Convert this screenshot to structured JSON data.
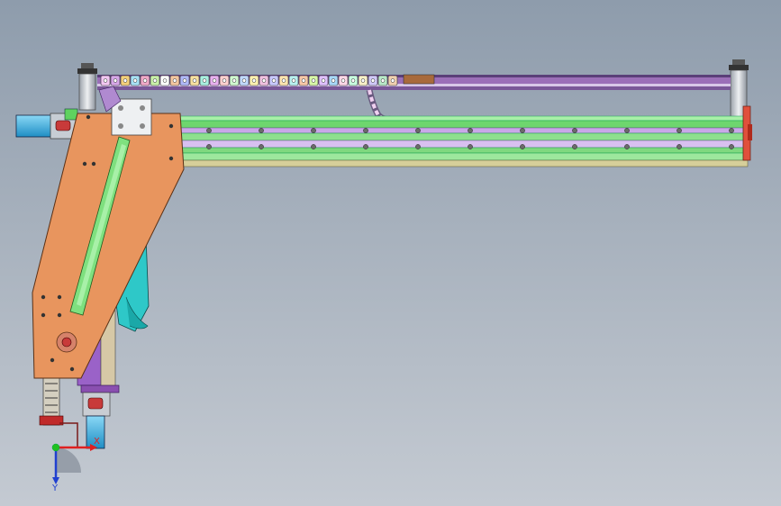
{
  "viewport": {
    "background_top": "#8e9cac",
    "background_bottom": "#c4cad2"
  },
  "colors": {
    "plate_orange": "#e8945e",
    "rail_green": "#7fe07f",
    "rail_purple": "#8a5fa8",
    "rail_violet": "#c7a0e0",
    "rail_tan": "#d8cf9a",
    "motor_blue": "#46b8e8",
    "cyan_part": "#33c9c9",
    "endcap_red": "#e04a3a",
    "silver": "#c9cdd3"
  },
  "triad": {
    "x_label": "X",
    "y_label": "Y",
    "x_color": "#e02020",
    "y_color": "#2040d0",
    "origin_color": "#20c020"
  },
  "drag_chain": {
    "link_colors": [
      "#f2c6f2",
      "#d6a6e8",
      "#f4d07a",
      "#a6e0f4",
      "#f0a8c8",
      "#c8f0a8",
      "#ffffff",
      "#f4c6a0",
      "#b0b8f8",
      "#f8e0a0",
      "#a8f0e0",
      "#e8b0f0",
      "#ffd0d0",
      "#d0f8d0",
      "#c0d8ff",
      "#fff0b0",
      "#f0c0e0",
      "#c8c8ff",
      "#ffe4b0",
      "#b8f0f0",
      "#f8c8a8",
      "#d8f8a8",
      "#e0c0ff",
      "#a8d8f8",
      "#ffd8e8",
      "#c8ffe0",
      "#f8f0c8",
      "#d0c8f8",
      "#b8e8c8",
      "#f0d0b0"
    ]
  }
}
